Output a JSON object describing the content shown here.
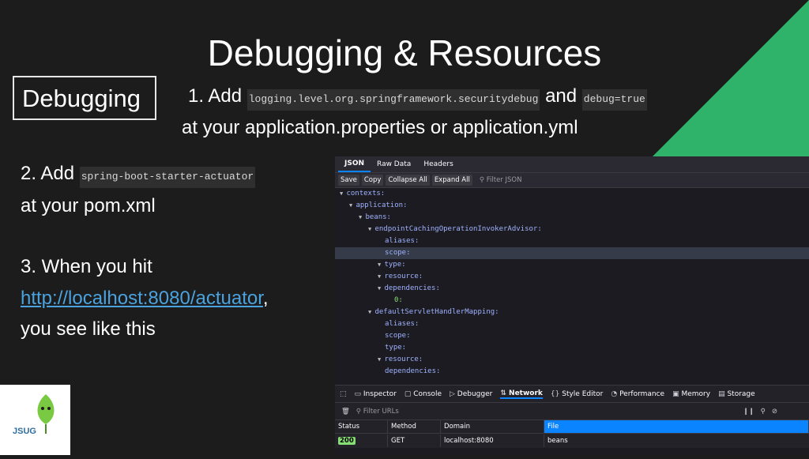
{
  "title": "Debugging & Resources",
  "box_label": "Debugging",
  "step1": {
    "prefix": "1. Add ",
    "code1": "logging.level.org.springframework.securityDebug",
    "code1_display": "logging.level.org.springframework.securitydebug",
    "middle": " and ",
    "code2": "debug=true",
    "line2": "at your application.properties or application.yml"
  },
  "step2": {
    "prefix": "2. Add ",
    "code": "spring-boot-starter-actuator",
    "line2": "at your pom.xml"
  },
  "step3": {
    "line1": "3. When you hit",
    "link": "http://localhost:8080/actuator",
    "after_link": ",",
    "line3": "you see like this"
  },
  "logo_text": "JSUG",
  "colors": {
    "background": "#1c1c1c",
    "triangle": "#2fb36a",
    "link": "#4aa3df"
  },
  "devtools": {
    "tabs": [
      "JSON",
      "Raw Data",
      "Headers"
    ],
    "buttons": [
      "Save",
      "Copy",
      "Collapse All",
      "Expand All"
    ],
    "filter_placeholder": "Filter JSON",
    "tree": [
      {
        "text": "contexts:",
        "depth": 0,
        "tw": true
      },
      {
        "text": "application:",
        "depth": 1,
        "tw": true
      },
      {
        "text": "beans:",
        "depth": 2,
        "tw": true
      },
      {
        "text": "endpointCachingOperationInvokerAdvisor:",
        "depth": 3,
        "tw": true
      },
      {
        "text": "aliases:",
        "depth": 4,
        "tw": false
      },
      {
        "text": "scope:",
        "depth": 4,
        "tw": false,
        "sel": true
      },
      {
        "text": "type:",
        "depth": 4,
        "tw": true
      },
      {
        "text": "resource:",
        "depth": 4,
        "tw": true
      },
      {
        "text": "dependencies:",
        "depth": 4,
        "tw": true
      },
      {
        "text": "0:",
        "depth": 5,
        "tw": false,
        "num": true
      },
      {
        "text": "defaultServletHandlerMapping:",
        "depth": 3,
        "tw": true
      },
      {
        "text": "aliases:",
        "depth": 4,
        "tw": false
      },
      {
        "text": "scope:",
        "depth": 4,
        "tw": false
      },
      {
        "text": "type:",
        "depth": 4,
        "tw": false
      },
      {
        "text": "resource:",
        "depth": 4,
        "tw": true
      },
      {
        "text": "dependencies:",
        "depth": 4,
        "tw": false
      }
    ],
    "tools": [
      "Inspector",
      "Console",
      "Debugger",
      "Network",
      "Style Editor",
      "Performance",
      "Memory",
      "Storage"
    ],
    "filter_urls": "Filter URLs",
    "columns": [
      "Status",
      "Method",
      "Domain",
      "File"
    ],
    "request": {
      "status": "200",
      "method": "GET",
      "domain": "localhost:8080",
      "file": "beans"
    }
  }
}
